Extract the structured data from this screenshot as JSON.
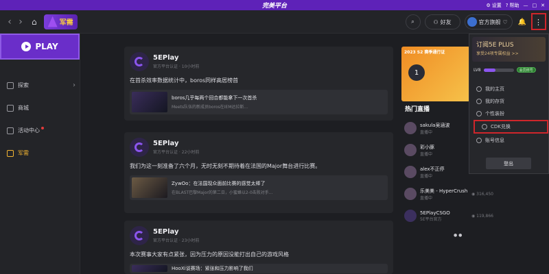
{
  "titlebar": {
    "logo": "完美平台",
    "settings": "设置",
    "help": "帮助"
  },
  "topbar": {
    "jun_label": "军需",
    "friends_label": "好友",
    "user_name": "官方旗舰"
  },
  "sidebar": {
    "play": "PLAY",
    "items": [
      {
        "label": "探索",
        "icon": "compass-icon"
      },
      {
        "label": "商城",
        "icon": "shop-icon"
      },
      {
        "label": "活动中心",
        "icon": "gift-icon"
      },
      {
        "label": "军需",
        "icon": "gun-icon"
      }
    ]
  },
  "feed": [
    {
      "name": "5EPlay",
      "meta_verified": "官方平台认证",
      "meta_time": "10小时前",
      "text": "在首杀效率数据统计中，boros同样高居榜首",
      "embed_title": "boros几乎每两个回合都能拿下一次首杀",
      "embed_desc": "Meets队伍的新成员boros在IEM达拉斯..."
    },
    {
      "name": "5EPlay",
      "meta_verified": "官方平台认证",
      "meta_time": "22小时前",
      "text": "我们为这一刻准备了六个月，无时无刻不期待着在法国的Major舞台进行比赛。",
      "embed_title": "ZywOo：在法国现众面前比赛的感觉太棒了",
      "embed_desc": "在BLAST巴黎Major的第二日，小蜜蜂以2-0击败对手..."
    },
    {
      "name": "5EPlay",
      "meta_verified": "官方平台认证",
      "meta_time": "23小时前",
      "text": "本次赛事大家有点紧张，因为压力的原因没能打出自己的游戏风格",
      "embed_title": "HooXi谈赛场：紧张和压力影响了我们",
      "embed_desc": ""
    }
  ],
  "right": {
    "banner_title": "2023 S2 赛季通行证",
    "banner_num": "1",
    "hot_title": "热门直播",
    "hot_list": [
      {
        "name": "sakula吴涵波",
        "status": "直播中",
        "views": ""
      },
      {
        "name": "彩小豚",
        "status": "直播中",
        "views": ""
      },
      {
        "name": "alex不正停",
        "status": "直播中",
        "views": ""
      },
      {
        "name": "乐美美 - HyperCrush",
        "status": "直播中",
        "views": "316,450"
      },
      {
        "name": "5EPlayCSGO",
        "status": "5E平台官方",
        "views": "119,866"
      }
    ]
  },
  "menu": {
    "plus_title": "订阅5E PLUS",
    "plus_sub": "享受24项专属权益 >>",
    "level": "LV8",
    "vip": "会员称号",
    "items": [
      {
        "label": "我的主页",
        "icon": "user-icon"
      },
      {
        "label": "我的存货",
        "icon": "box-icon"
      },
      {
        "label": "个性装扮",
        "icon": "wand-icon"
      },
      {
        "label": "CDK兑换",
        "icon": "cdk-icon"
      },
      {
        "label": "账号信息",
        "icon": "info-icon"
      }
    ],
    "logout": "登出",
    "level_fill": 0.4
  }
}
